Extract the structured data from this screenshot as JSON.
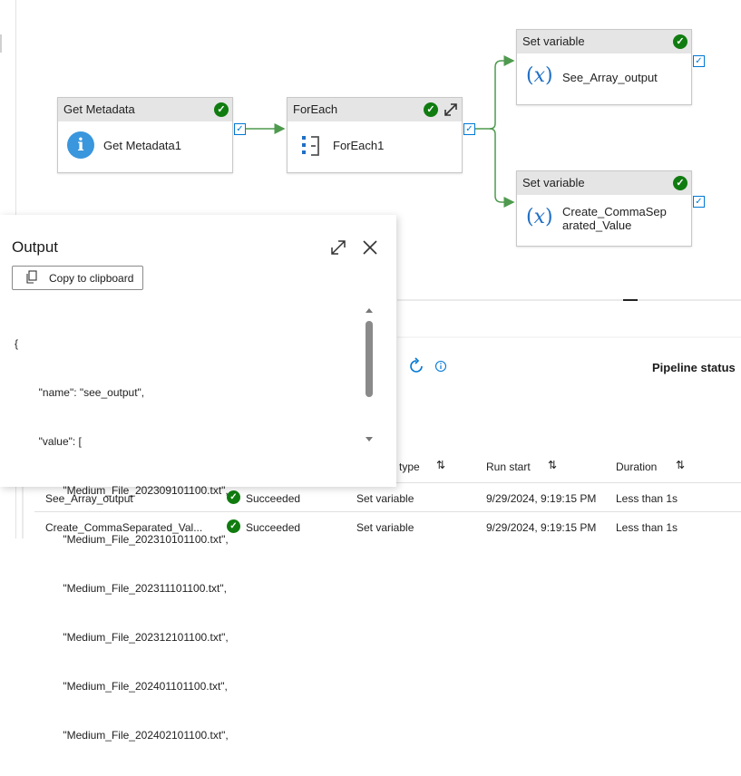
{
  "pipeline": {
    "nodes": [
      {
        "type": "Get Metadata",
        "name": "Get Metadata1"
      },
      {
        "type": "ForEach",
        "name": "ForEach1"
      },
      {
        "type": "Set variable",
        "name": "See_Array_output"
      },
      {
        "type": "Set variable",
        "name_line1": "Create_CommaSep",
        "name_line2": "arated_Value"
      }
    ]
  },
  "output": {
    "title": "Output",
    "copy_label": "Copy to clipboard",
    "json_lines": [
      "{",
      "        \"name\": \"see_output\",",
      "        \"value\": [",
      "                \"Medium_File_202309101100.txt\",",
      "                \"Medium_File_202310101100.txt\",",
      "                \"Medium_File_202311101100.txt\",",
      "                \"Medium_File_202312101100.txt\",",
      "                \"Medium_File_202401101100.txt\",",
      "                \"Medium_File_202402101100.txt\","
    ]
  },
  "status": {
    "pipeline_status_label": "Pipeline status"
  },
  "table": {
    "headers": {
      "type": "type",
      "run_start": "Run start",
      "duration": "Duration"
    },
    "rows": [
      {
        "name": "See_Array_output",
        "status": "Succeeded",
        "type": "Set variable",
        "run_start": "9/29/2024, 9:19:15 PM",
        "duration": "Less than 1s"
      },
      {
        "name": "Create_CommaSeparated_Val...",
        "status": "Succeeded",
        "type": "Set variable",
        "run_start": "9/29/2024, 9:19:15 PM",
        "duration": "Less than 1s"
      }
    ]
  },
  "colors": {
    "success": "#107c10",
    "connector": "#4e9a4e",
    "accent": "#0078d4"
  },
  "icons": [
    "info-icon",
    "foreach-icon",
    "variable-icon",
    "check-circle-icon",
    "expand-icon",
    "close-icon",
    "copy-icon",
    "refresh-icon",
    "info-outline-icon",
    "sort-icon"
  ]
}
